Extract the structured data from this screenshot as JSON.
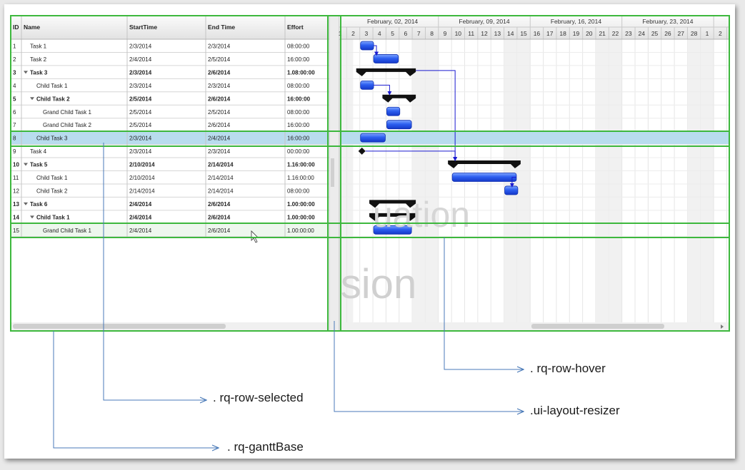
{
  "grid": {
    "columns": [
      "ID",
      "Name",
      "StartTime",
      "End Time",
      "Effort"
    ],
    "rows": [
      {
        "id": "1",
        "name": "Task 1",
        "start": "2/3/2014",
        "end": "2/3/2014",
        "effort": "08:00:00",
        "level": 1,
        "parent": false
      },
      {
        "id": "2",
        "name": "Task 2",
        "start": "2/4/2014",
        "end": "2/5/2014",
        "effort": "16:00:00",
        "level": 1,
        "parent": false
      },
      {
        "id": "3",
        "name": "Task 3",
        "start": "2/3/2014",
        "end": "2/6/2014",
        "effort": "1.08:00:00",
        "level": 1,
        "parent": true
      },
      {
        "id": "4",
        "name": "Child Task 1",
        "start": "2/3/2014",
        "end": "2/3/2014",
        "effort": "08:00:00",
        "level": 2,
        "parent": false
      },
      {
        "id": "5",
        "name": "Child Task 2",
        "start": "2/5/2014",
        "end": "2/6/2014",
        "effort": "16:00:00",
        "level": 2,
        "parent": true
      },
      {
        "id": "6",
        "name": "Grand Child Task 1",
        "start": "2/5/2014",
        "end": "2/5/2014",
        "effort": "08:00:00",
        "level": 3,
        "parent": false
      },
      {
        "id": "7",
        "name": "Grand Child Task 2",
        "start": "2/5/2014",
        "end": "2/6/2014",
        "effort": "16:00:00",
        "level": 3,
        "parent": false
      },
      {
        "id": "8",
        "name": "Child Task 3",
        "start": "2/3/2014",
        "end": "2/4/2014",
        "effort": "16:00:00",
        "level": 2,
        "parent": false,
        "selected": true
      },
      {
        "id": "9",
        "name": "Task 4",
        "start": "2/3/2014",
        "end": "2/3/2014",
        "effort": "00:00:00",
        "level": 1,
        "parent": false
      },
      {
        "id": "10",
        "name": "Task 5",
        "start": "2/10/2014",
        "end": "2/14/2014",
        "effort": "1.16:00:00",
        "level": 1,
        "parent": true
      },
      {
        "id": "11",
        "name": "Child Task 1",
        "start": "2/10/2014",
        "end": "2/14/2014",
        "effort": "1.16:00:00",
        "level": 2,
        "parent": false
      },
      {
        "id": "12",
        "name": "Child Task 2",
        "start": "2/14/2014",
        "end": "2/14/2014",
        "effort": "08:00:00",
        "level": 2,
        "parent": false
      },
      {
        "id": "13",
        "name": "Task 6",
        "start": "2/4/2014",
        "end": "2/6/2014",
        "effort": "1.00:00:00",
        "level": 1,
        "parent": true
      },
      {
        "id": "14",
        "name": "Child Task 1",
        "start": "2/4/2014",
        "end": "2/6/2014",
        "effort": "1.00:00:00",
        "level": 2,
        "parent": true
      },
      {
        "id": "15",
        "name": "Grand Child Task 1",
        "start": "2/4/2014",
        "end": "2/6/2014",
        "effort": "1.00:00:00",
        "level": 3,
        "parent": false,
        "hover": true
      }
    ]
  },
  "timeline": {
    "weeks": [
      "February, 02, 2014",
      "February, 09, 2014",
      "February, 16, 2014",
      "February, 23, 2014"
    ],
    "days": [
      "1",
      "2",
      "3",
      "4",
      "5",
      "6",
      "7",
      "8",
      "9",
      "10",
      "11",
      "12",
      "13",
      "14",
      "15",
      "16",
      "17",
      "18",
      "19",
      "20",
      "21",
      "22",
      "23",
      "24",
      "25",
      "26",
      "27",
      "28",
      "1",
      "2"
    ]
  },
  "watermark": {
    "line1": "uation",
    "line2": "sion"
  },
  "annotations": {
    "row_hover": ". rq-row-hover",
    "row_selected": ". rq-row-selected",
    "layout_resizer": ".ui-layout-resizer",
    "gantt_base": ". rq-ganttBase"
  },
  "colors": {
    "frame_green": "#3db83d",
    "selected_row": "#b8dcee",
    "bar_blue": "#1b4fe6",
    "annotation_line": "#4a7ab8"
  }
}
